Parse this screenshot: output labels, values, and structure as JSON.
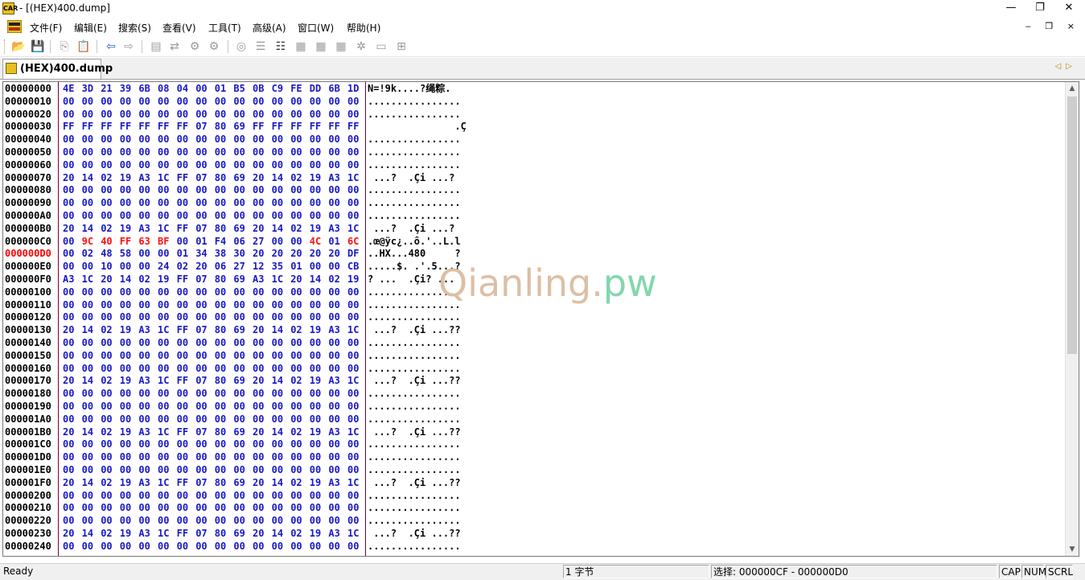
{
  "window": {
    "title": "- [(HEX)400.dump]",
    "app_icon_text": "CAR",
    "minimize": "—",
    "maximize": "❐",
    "close": "✕"
  },
  "menu": {
    "items": [
      "文件(F)",
      "编辑(E)",
      "搜索(S)",
      "查看(V)",
      "工具(T)",
      "高级(A)",
      "窗口(W)",
      "帮助(H)"
    ],
    "mdi_controls": "‒ ❐ ×"
  },
  "toolbar": {
    "icons": [
      "open-icon",
      "save-icon",
      "copy-icon",
      "paste-icon",
      "back-arrow-icon",
      "forward-arrow-icon",
      "tool-icon-1",
      "tool-icon-2",
      "tool-icon-3",
      "tool-icon-4",
      "tool-icon-5",
      "tool-icon-6",
      "tool-icon-7",
      "tool-icon-8",
      "tool-icon-9",
      "tool-icon-10",
      "tool-icon-11",
      "tool-icon-12"
    ]
  },
  "tab": {
    "label": "(HEX)400.dump",
    "scroll_left": "◁",
    "scroll_right": "▷"
  },
  "hex": {
    "selected_address": "000000D0",
    "rows": [
      {
        "addr": "00000000",
        "bytes": "4E 3D 21 39 6B 08 04 00 01 B5 0B C9 FE DD 6B 1D",
        "ascii": "N=!9k....?绳粽."
      },
      {
        "addr": "00000010",
        "bytes": "00 00 00 00 00 00 00 00 00 00 00 00 00 00 00 00",
        "ascii": "................"
      },
      {
        "addr": "00000020",
        "bytes": "00 00 00 00 00 00 00 00 00 00 00 00 00 00 00 00",
        "ascii": "................"
      },
      {
        "addr": "00000030",
        "bytes": "FF FF FF FF FF FF FF 07 80 69 FF FF FF FF FF FF",
        "ascii": "               .Ç"
      },
      {
        "addr": "00000040",
        "bytes": "00 00 00 00 00 00 00 00 00 00 00 00 00 00 00 00",
        "ascii": "................"
      },
      {
        "addr": "00000050",
        "bytes": "00 00 00 00 00 00 00 00 00 00 00 00 00 00 00 00",
        "ascii": "................"
      },
      {
        "addr": "00000060",
        "bytes": "00 00 00 00 00 00 00 00 00 00 00 00 00 00 00 00",
        "ascii": "................"
      },
      {
        "addr": "00000070",
        "bytes": "20 14 02 19 A3 1C FF 07 80 69 20 14 02 19 A3 1C",
        "ascii": " ...?  .Çi ...?"
      },
      {
        "addr": "00000080",
        "bytes": "00 00 00 00 00 00 00 00 00 00 00 00 00 00 00 00",
        "ascii": "................"
      },
      {
        "addr": "00000090",
        "bytes": "00 00 00 00 00 00 00 00 00 00 00 00 00 00 00 00",
        "ascii": "................"
      },
      {
        "addr": "000000A0",
        "bytes": "00 00 00 00 00 00 00 00 00 00 00 00 00 00 00 00",
        "ascii": "................"
      },
      {
        "addr": "000000B0",
        "bytes": "20 14 02 19 A3 1C FF 07 80 69 20 14 02 19 A3 1C",
        "ascii": " ...?  .Çi ...?"
      },
      {
        "addr": "000000C0",
        "bytes": "00 9C 40 FF 63 BF 00 01 F4 06 27 00 00 4C 01 6C",
        "ascii": ".œ@ÿc¿..ô.'..L.l",
        "red": [
          1,
          2,
          3,
          4,
          5,
          13,
          15
        ]
      },
      {
        "addr": "000000D0",
        "bytes": "00 02 48 58 00 00 01 34 38 30 20 20 20 20 20 DF",
        "ascii": "..HX...480     ?"
      },
      {
        "addr": "000000E0",
        "bytes": "00 00 10 00 00 24 02 20 06 27 12 35 01 00 00 CB",
        "ascii": ".....$. .'.5...?"
      },
      {
        "addr": "000000F0",
        "bytes": "A3 1C 20 14 02 19 FF 07 80 69 A3 1C 20 14 02 19",
        "ascii": "? ...  .Çi? ..."
      },
      {
        "addr": "00000100",
        "bytes": "00 00 00 00 00 00 00 00 00 00 00 00 00 00 00 00",
        "ascii": "................"
      },
      {
        "addr": "00000110",
        "bytes": "00 00 00 00 00 00 00 00 00 00 00 00 00 00 00 00",
        "ascii": "................"
      },
      {
        "addr": "00000120",
        "bytes": "00 00 00 00 00 00 00 00 00 00 00 00 00 00 00 00",
        "ascii": "................"
      },
      {
        "addr": "00000130",
        "bytes": "20 14 02 19 A3 1C FF 07 80 69 20 14 02 19 A3 1C",
        "ascii": " ...?  .Çi ...??"
      },
      {
        "addr": "00000140",
        "bytes": "00 00 00 00 00 00 00 00 00 00 00 00 00 00 00 00",
        "ascii": "................"
      },
      {
        "addr": "00000150",
        "bytes": "00 00 00 00 00 00 00 00 00 00 00 00 00 00 00 00",
        "ascii": "................"
      },
      {
        "addr": "00000160",
        "bytes": "00 00 00 00 00 00 00 00 00 00 00 00 00 00 00 00",
        "ascii": "................"
      },
      {
        "addr": "00000170",
        "bytes": "20 14 02 19 A3 1C FF 07 80 69 20 14 02 19 A3 1C",
        "ascii": " ...?  .Çi ...??"
      },
      {
        "addr": "00000180",
        "bytes": "00 00 00 00 00 00 00 00 00 00 00 00 00 00 00 00",
        "ascii": "................"
      },
      {
        "addr": "00000190",
        "bytes": "00 00 00 00 00 00 00 00 00 00 00 00 00 00 00 00",
        "ascii": "................"
      },
      {
        "addr": "000001A0",
        "bytes": "00 00 00 00 00 00 00 00 00 00 00 00 00 00 00 00",
        "ascii": "................"
      },
      {
        "addr": "000001B0",
        "bytes": "20 14 02 19 A3 1C FF 07 80 69 20 14 02 19 A3 1C",
        "ascii": " ...?  .Çi ...??"
      },
      {
        "addr": "000001C0",
        "bytes": "00 00 00 00 00 00 00 00 00 00 00 00 00 00 00 00",
        "ascii": "................"
      },
      {
        "addr": "000001D0",
        "bytes": "00 00 00 00 00 00 00 00 00 00 00 00 00 00 00 00",
        "ascii": "................"
      },
      {
        "addr": "000001E0",
        "bytes": "00 00 00 00 00 00 00 00 00 00 00 00 00 00 00 00",
        "ascii": "................"
      },
      {
        "addr": "000001F0",
        "bytes": "20 14 02 19 A3 1C FF 07 80 69 20 14 02 19 A3 1C",
        "ascii": " ...?  .Çi ...??"
      },
      {
        "addr": "00000200",
        "bytes": "00 00 00 00 00 00 00 00 00 00 00 00 00 00 00 00",
        "ascii": "................"
      },
      {
        "addr": "00000210",
        "bytes": "00 00 00 00 00 00 00 00 00 00 00 00 00 00 00 00",
        "ascii": "................"
      },
      {
        "addr": "00000220",
        "bytes": "00 00 00 00 00 00 00 00 00 00 00 00 00 00 00 00",
        "ascii": "................"
      },
      {
        "addr": "00000230",
        "bytes": "20 14 02 19 A3 1C FF 07 80 69 20 14 02 19 A3 1C",
        "ascii": " ...?  .Çi ...??"
      },
      {
        "addr": "00000240",
        "bytes": "00 00 00 00 00 00 00 00 00 00 00 00 00 00 00 00",
        "ascii": "................"
      }
    ]
  },
  "watermark": {
    "part1": "Qianling.",
    "part2": "pw"
  },
  "status": {
    "ready": "Ready",
    "size": "1 字节",
    "selection": "选择: 000000CF - 000000D0",
    "cap": "CAP",
    "num": "NUM",
    "scrl": "SCRL"
  },
  "colors": {
    "hex_byte": "#1818c8",
    "highlight_red": "#ff1010",
    "divider": "#7a0030",
    "watermark_left": "#dcbfa5",
    "watermark_right": "#83d6ae"
  }
}
